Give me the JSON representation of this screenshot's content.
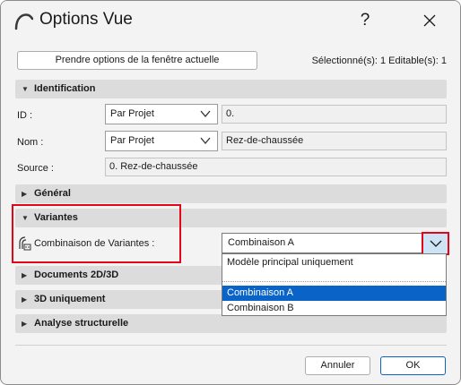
{
  "window": {
    "title": "Options Vue",
    "help_label": "?",
    "close_icon": "close-icon",
    "app_icon": "archicad-arc-icon"
  },
  "toolbar": {
    "grab_label": "Prendre options de la fenêtre actuelle",
    "selection_info": "Sélectionné(s): 1 Editable(s): 1"
  },
  "sections": {
    "identification": "Identification",
    "general": "Général",
    "variantes": "Variantes",
    "docs2d3d": "Documents 2D/3D",
    "uniquement3d": "3D uniquement",
    "structural": "Analyse structurelle"
  },
  "identification": {
    "id_label": "ID :",
    "id_dropdown": "Par Projet",
    "id_value": "0.",
    "nom_label": "Nom :",
    "nom_dropdown": "Par Projet",
    "nom_value": "Rez-de-chaussée",
    "source_label": "Source :",
    "source_value": "0. Rez-de-chaussée"
  },
  "variantes": {
    "combination_label": "Combinaison de Variantes :",
    "combination_selected": "Combinaison A",
    "options": [
      "Modèle principal uniquement",
      "Combinaison A",
      "Combinaison B"
    ],
    "selected_option": "Combinaison A"
  },
  "footer": {
    "cancel_label": "Annuler",
    "ok_label": "OK"
  },
  "colors": {
    "highlight": "#e3061a",
    "selection": "#0a64c8",
    "section_bg": "#dcdcdc"
  }
}
